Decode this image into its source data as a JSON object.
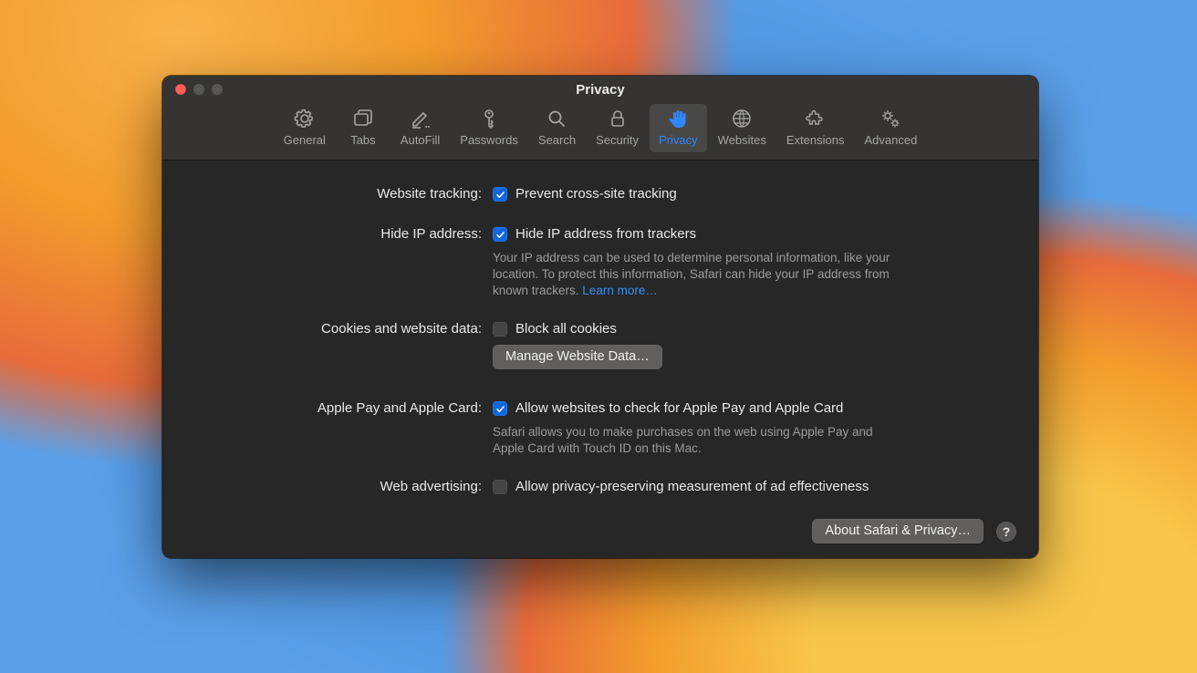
{
  "window": {
    "title": "Privacy"
  },
  "tabs": [
    {
      "label": "General",
      "icon": "gear"
    },
    {
      "label": "Tabs",
      "icon": "tabs"
    },
    {
      "label": "AutoFill",
      "icon": "pencil"
    },
    {
      "label": "Passwords",
      "icon": "key"
    },
    {
      "label": "Search",
      "icon": "search"
    },
    {
      "label": "Security",
      "icon": "lock"
    },
    {
      "label": "Privacy",
      "icon": "hand",
      "active": true
    },
    {
      "label": "Websites",
      "icon": "globe"
    },
    {
      "label": "Extensions",
      "icon": "puzzle"
    },
    {
      "label": "Advanced",
      "icon": "gears"
    }
  ],
  "rows": {
    "tracking": {
      "label": "Website tracking:",
      "checkbox": {
        "checked": true,
        "text": "Prevent cross-site tracking"
      }
    },
    "ip": {
      "label": "Hide IP address:",
      "checkbox": {
        "checked": true,
        "text": "Hide IP address from trackers"
      },
      "desc": "Your IP address can be used to determine personal information, like your location. To protect this information, Safari can hide your IP address from known trackers. ",
      "learn_more": "Learn more…"
    },
    "cookies": {
      "label": "Cookies and website data:",
      "checkbox": {
        "checked": false,
        "text": "Block all cookies"
      },
      "button": "Manage Website Data…"
    },
    "applepay": {
      "label": "Apple Pay and Apple Card:",
      "checkbox": {
        "checked": true,
        "text": "Allow websites to check for Apple Pay and Apple Card"
      },
      "desc": "Safari allows you to make purchases on the web using Apple Pay and Apple Card with Touch ID on this Mac."
    },
    "ads": {
      "label": "Web advertising:",
      "checkbox": {
        "checked": false,
        "text": "Allow privacy-preserving measurement of ad effectiveness"
      }
    }
  },
  "footer": {
    "about": "About Safari & Privacy…",
    "help": "?"
  }
}
